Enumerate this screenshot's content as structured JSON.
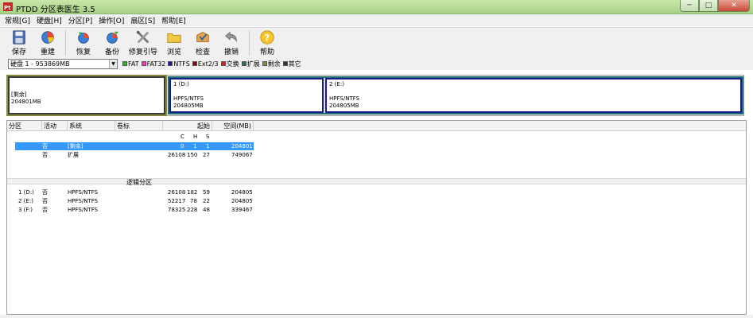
{
  "window": {
    "title": "PTDD 分区表医生 3.5"
  },
  "window_controls": {
    "minimize": "─",
    "maximize": "□",
    "close": "✕"
  },
  "menu": [
    "常规[G]",
    "硬盘[H]",
    "分区[P]",
    "操作[O]",
    "扇区[S]",
    "帮助[E]"
  ],
  "toolbar": {
    "save": "保存",
    "rebuild": "重建",
    "restore": "恢复",
    "backup": "备份",
    "repair_boot": "修复引导",
    "browse": "浏览",
    "check": "检查",
    "undo": "撤销",
    "help": "帮助"
  },
  "disk": {
    "selected": "硬盘 1 - 953869MB",
    "arrow": "▼"
  },
  "legend": [
    {
      "label": "FAT",
      "color": "#2db82d"
    },
    {
      "label": "FAT32",
      "color": "#ff33cc"
    },
    {
      "label": "NTFS",
      "color": "#1a1a8c"
    },
    {
      "label": "Ext2/3",
      "color": "#8b0000"
    },
    {
      "label": "交换",
      "color": "#e02020"
    },
    {
      "label": "扩展",
      "color": "#1e7070"
    },
    {
      "label": "剩余",
      "color": "#8b8b40"
    },
    {
      "label": "其它",
      "color": "#333333"
    }
  ],
  "diskmap": {
    "free": {
      "label": "[剩余]",
      "size": "204801MB"
    },
    "p1": {
      "label": "1 (D:)",
      "fs": "HPFS/NTFS",
      "size": "204805MB"
    },
    "p2": {
      "label": "2 (E:)",
      "fs": "HPFS/NTFS",
      "size": "204805MB"
    }
  },
  "table": {
    "headers": {
      "partition": "分区",
      "active": "活动",
      "system": "系统",
      "label": "卷标",
      "start": "起始",
      "space": "空间(MB)"
    },
    "chs": {
      "c": "C",
      "h": "H",
      "s": "S"
    },
    "primary_rows": [
      {
        "partition": "",
        "active": "否",
        "system": "[剩余]",
        "c": "0",
        "h": "1",
        "s": "1",
        "space": "204801"
      },
      {
        "partition": "",
        "active": "否",
        "system": "扩展",
        "c": "26108",
        "h": "150",
        "s": "27",
        "space": "749067"
      }
    ],
    "logical_title": "逻辑分区",
    "logical_rows": [
      {
        "partition": "1 (D:)",
        "active": "否",
        "system": "HPFS/NTFS",
        "c": "26108",
        "h": "182",
        "s": "59",
        "space": "204805"
      },
      {
        "partition": "2 (E:)",
        "active": "否",
        "system": "HPFS/NTFS",
        "c": "52217",
        "h": "78",
        "s": "22",
        "space": "204805"
      },
      {
        "partition": "3 (F:)",
        "active": "否",
        "system": "HPFS/NTFS",
        "c": "78325",
        "h": "228",
        "s": "48",
        "space": "339467"
      }
    ]
  }
}
